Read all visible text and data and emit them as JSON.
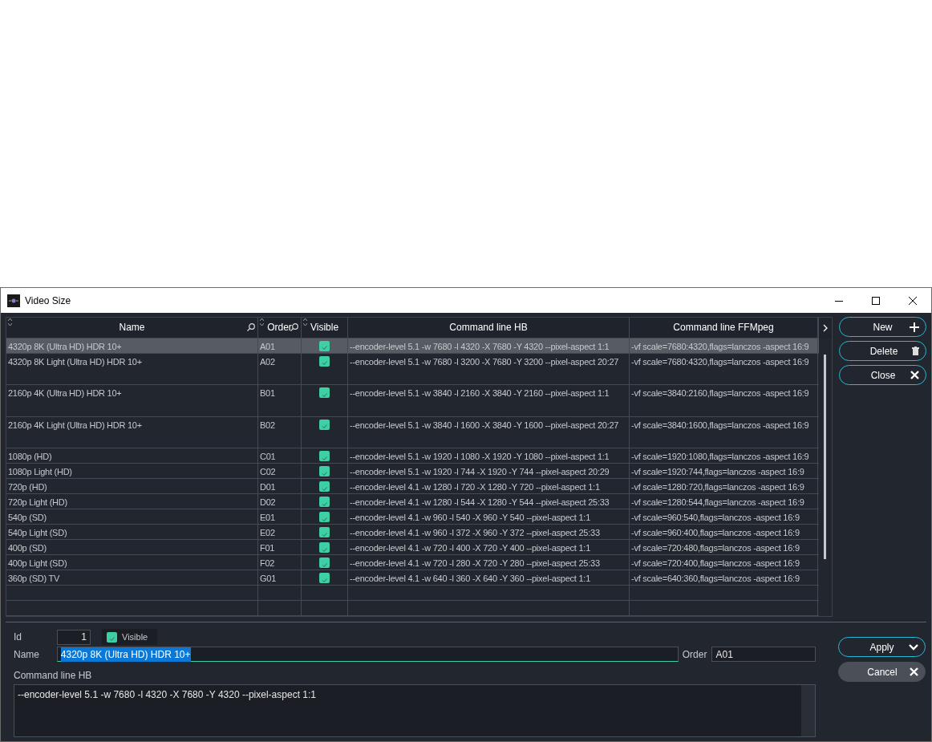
{
  "window": {
    "title": "Video Size"
  },
  "table": {
    "columns": [
      {
        "label": "Name",
        "sortable": true,
        "searchable": true
      },
      {
        "label": "Order",
        "sortable": true,
        "searchable": true
      },
      {
        "label": "Visible",
        "sortable": true,
        "searchable": false
      },
      {
        "label": "Command line HB",
        "sortable": false,
        "searchable": false
      },
      {
        "label": "Command line FFMpeg",
        "sortable": false,
        "searchable": false
      }
    ],
    "rows": [
      {
        "kind": "short",
        "selected": true,
        "name": "4320p 8K (Ultra HD) HDR 10+",
        "order": "A01",
        "visible": true,
        "hb": "--encoder-level 5.1 -w 7680 -l 4320  -X 7680 -Y 4320 --pixel-aspect 1:1",
        "ffmpeg": "-vf scale=7680:4320,flags=lanczos -aspect 16:9"
      },
      {
        "kind": "tall",
        "selected": false,
        "name": "4320p 8K Light (Ultra HD) HDR 10+",
        "order": "A02",
        "visible": true,
        "hb": "--encoder-level 5.1 -w 7680 -l 3200  -X 7680 -Y 3200 --pixel-aspect 20:27",
        "ffmpeg": "-vf scale=7680:4320,flags=lanczos -aspect 16:9"
      },
      {
        "kind": "tall",
        "selected": false,
        "name": "2160p 4K (Ultra HD) HDR 10+",
        "order": "B01",
        "visible": true,
        "hb": "--encoder-level 5.1 -w 3840 -l 2160  -X 3840 -Y 2160 --pixel-aspect  1:1",
        "ffmpeg": "-vf scale=3840:2160,flags=lanczos -aspect 16:9"
      },
      {
        "kind": "tall",
        "selected": false,
        "name": "2160p 4K Light (Ultra HD) HDR 10+",
        "order": "B02",
        "visible": true,
        "hb": "--encoder-level 5.1 -w 3840 -l 1600  -X 3840 -Y 1600 --pixel-aspect 20:27",
        "ffmpeg": "-vf scale=3840:1600,flags=lanczos -aspect 16:9"
      },
      {
        "kind": "short",
        "selected": false,
        "name": "1080p (HD)",
        "order": "C01",
        "visible": true,
        "hb": "--encoder-level 5.1 -w 1920 -l 1080  -X 1920 -Y 1080 --pixel-aspect 1:1",
        "ffmpeg": "-vf scale=1920:1080,flags=lanczos -aspect 16:9"
      },
      {
        "kind": "short",
        "selected": false,
        "name": "1080p Light (HD)",
        "order": "C02",
        "visible": true,
        "hb": "--encoder-level 5.1 -w 1920 -l 744  -X 1920 -Y 744 --pixel-aspect 20:29",
        "ffmpeg": "-vf scale=1920:744,flags=lanczos -aspect 16:9"
      },
      {
        "kind": "short",
        "selected": false,
        "name": "720p (HD)",
        "order": "D01",
        "visible": true,
        "hb": "--encoder-level 4.1 -w 1280 -l 720  -X 1280 -Y 720 --pixel-aspect 1:1",
        "ffmpeg": "-vf scale=1280:720,flags=lanczos -aspect 16:9"
      },
      {
        "kind": "short",
        "selected": false,
        "name": "720p Light (HD)",
        "order": "D02",
        "visible": true,
        "hb": "--encoder-level 4.1 -w 1280 -l 544  -X 1280 -Y 544 --pixel-aspect 25:33",
        "ffmpeg": "-vf scale=1280:544,flags=lanczos -aspect 16:9"
      },
      {
        "kind": "short",
        "selected": false,
        "name": "540p (SD)",
        "order": "E01",
        "visible": true,
        "hb": "--encoder-level 4.1 -w 960 -l 540  -X 960 -Y 540 --pixel-aspect 1:1",
        "ffmpeg": "-vf scale=960:540,flags=lanczos -aspect 16:9"
      },
      {
        "kind": "short",
        "selected": false,
        "name": "540p Light (SD)",
        "order": "E02",
        "visible": true,
        "hb": "--encoder-level 4.1 -w 960 -l 372  -X 960 -Y 372 --pixel-aspect 25:33",
        "ffmpeg": "-vf scale=960:400,flags=lanczos -aspect 16:9"
      },
      {
        "kind": "short",
        "selected": false,
        "name": "400p (SD)",
        "order": "F01",
        "visible": true,
        "hb": "--encoder-level 4.1 -w 720 -l 400  -X 720 -Y 400 --pixel-aspect 1:1",
        "ffmpeg": "-vf scale=720:480,flags=lanczos -aspect 16:9"
      },
      {
        "kind": "short",
        "selected": false,
        "name": "400p Light (SD)",
        "order": "F02",
        "visible": true,
        "hb": "--encoder-level 4.1 -w 720 -l 280  -X 720 -Y 280 --pixel-aspect 25:33",
        "ffmpeg": "-vf scale=720:400,flags=lanczos -aspect 16:9"
      },
      {
        "kind": "short",
        "selected": false,
        "name": "360p (SD) TV",
        "order": "G01",
        "visible": true,
        "hb": "--encoder-level 4.1 -w 640 -l 360  -X 640 -Y 360 --pixel-aspect 1:1",
        "ffmpeg": "-vf scale=640:360,flags=lanczos -aspect 16:9"
      }
    ]
  },
  "side_buttons": [
    {
      "label": "New"
    },
    {
      "label": "Delete"
    },
    {
      "label": "Close"
    }
  ],
  "form": {
    "id_label": "Id",
    "id_value": "1",
    "visible_label": "Visible",
    "visible_checked": true,
    "name_label": "Name",
    "name_value": "4320p 8K (Ultra HD) HDR 10+",
    "order_label": "Order",
    "order_value": "A01",
    "hb_label": "Command line HB",
    "hb_value": "--encoder-level 5.1 -w 7680 -l 4320  -X 7680 -Y 4320 --pixel-aspect 1:1"
  },
  "form_buttons": [
    {
      "label": "Apply"
    },
    {
      "label": "Cancel"
    }
  ]
}
